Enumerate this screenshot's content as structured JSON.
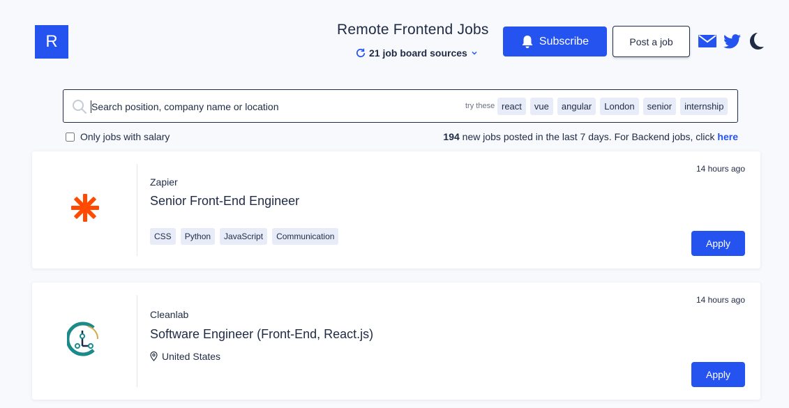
{
  "header": {
    "logo_letter": "R",
    "title": "Remote Frontend Jobs",
    "sources_label": "21 job board sources",
    "subscribe_label": "Subscribe",
    "post_job_label": "Post a job",
    "icons": [
      "mail-icon",
      "twitter-icon",
      "moon-icon"
    ]
  },
  "search": {
    "placeholder": "Search position, company name or location",
    "try_label": "try these",
    "suggestions": [
      "react",
      "vue",
      "angular",
      "London",
      "senior",
      "internship"
    ]
  },
  "filters": {
    "salary_label": "Only jobs with salary",
    "salary_checked": false
  },
  "stats": {
    "count": "194",
    "text": "new jobs posted in the last 7 days. For Backend jobs, click",
    "link_label": "here"
  },
  "jobs": [
    {
      "company": "Zapier",
      "title": "Senior Front-End Engineer",
      "time_ago": "14 hours ago",
      "tags": [
        "CSS",
        "Python",
        "JavaScript",
        "Communication"
      ],
      "location": "",
      "apply_label": "Apply",
      "logo": "zapier-logo"
    },
    {
      "company": "Cleanlab",
      "title": "Software Engineer (Front-End, React.js)",
      "time_ago": "14 hours ago",
      "tags": [],
      "location": "United States",
      "apply_label": "Apply",
      "logo": "cleanlab-logo"
    }
  ],
  "colors": {
    "accent": "#2453f0",
    "text": "#1f2a44",
    "background": "#f7f9fc",
    "chip_bg": "#e8ecf8",
    "zapier_orange": "#ff4a00",
    "cleanlab_teal": "#1a8a8a",
    "cleanlab_gold": "#d4a84b"
  }
}
